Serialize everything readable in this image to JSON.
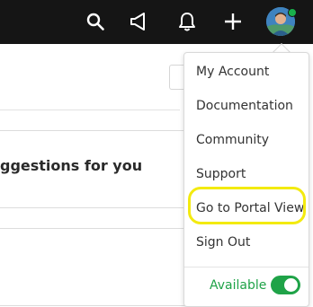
{
  "topbar": {
    "icons": {
      "search": "search-icon",
      "announce": "megaphone-icon",
      "notify": "bell-icon",
      "add": "plus-icon"
    },
    "status_color": "#19b04b"
  },
  "background": {
    "heading_fragment": "ggestions for you"
  },
  "menu": {
    "items": [
      {
        "label": "My Account"
      },
      {
        "label": "Documentation"
      },
      {
        "label": "Community"
      },
      {
        "label": "Support"
      },
      {
        "label": "Go to Portal View"
      },
      {
        "label": "Sign Out"
      }
    ],
    "availability": {
      "label": "Available",
      "on": true,
      "color": "#1fa348"
    },
    "highlighted_item": "Go to Portal View",
    "highlight_color": "#f3ea10"
  }
}
